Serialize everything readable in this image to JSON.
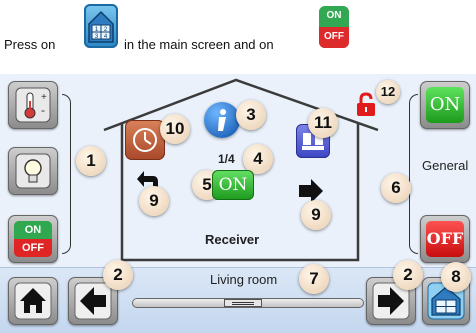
{
  "instruction": {
    "part1": "Press on",
    "part2": "in the main screen and on"
  },
  "icons": {
    "menu": "room-menu-icon",
    "onoff": "on-off-icon"
  },
  "onoff_icon": {
    "on": "ON",
    "off": "OFF"
  },
  "house": {
    "page_indicator": "1/4",
    "receiver_label": "Receiver",
    "on_button": "ON"
  },
  "side": {
    "general_label": "General",
    "on_label": "ON",
    "off_label": "OFF",
    "left_onoff_on": "ON",
    "left_onoff_off": "OFF"
  },
  "bottom": {
    "room_name": "Living room"
  },
  "callouts": {
    "c1": "1",
    "c2a": "2",
    "c2b": "2",
    "c3": "3",
    "c4": "4",
    "c5": "5",
    "c6": "6",
    "c7": "7",
    "c8": "8",
    "c9a": "9",
    "c9b": "9",
    "c10": "10",
    "c11": "11",
    "c12": "12"
  },
  "colors": {
    "on_green": "#2fbf2f",
    "off_red": "#e01b1b",
    "accent_blue": "#2a86c6",
    "screen_bg": "#eaf1fb"
  }
}
